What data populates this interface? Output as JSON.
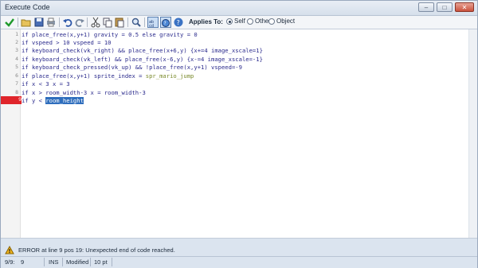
{
  "window": {
    "title": "Execute Code"
  },
  "toolbar": {
    "applies_label": "Applies To:",
    "options": [
      {
        "label": "Self",
        "selected": true
      },
      {
        "label": "Other",
        "selected": false
      },
      {
        "label": "Object",
        "selected": false
      }
    ]
  },
  "editor": {
    "line_numbers": [
      "1",
      "2",
      "3",
      "4",
      "5",
      "6",
      "7",
      "8",
      "9"
    ],
    "lines": [
      "if place_free(x,y+1) gravity = 0.5 else gravity = 0",
      "if vspeed > 10 vspeed = 10",
      "if keyboard_check(vk_right) && place_free(x+6,y) {x+=4 image_xscale=1}",
      "if keyboard_check(vk_left) && place_free(x-6,y) {x-=4 image_xscale=-1}",
      "if keyboard_check_pressed(vk_up) && !place_free(x,y+1) vspeed=-9",
      "if place_free(x,y+1) sprite_index = ",
      "if x < 3 x = 3",
      "if x > room_width-3 x = room_width-3",
      "if y < "
    ],
    "line6_resource": "spr_mario_jump",
    "line9_selected": "room_height"
  },
  "error": {
    "message": "ERROR at line 9 pos 19: Unexpected end of code reached."
  },
  "status": {
    "position": "9/9:",
    "column": "9",
    "mode": "INS",
    "state": "Modified",
    "font_size": "10 pt"
  },
  "colors": {
    "error_marker": "#e0252b",
    "selection": "#2f6ebd",
    "code_text": "#2a2a8c",
    "resource_text": "#7a8a2b"
  }
}
